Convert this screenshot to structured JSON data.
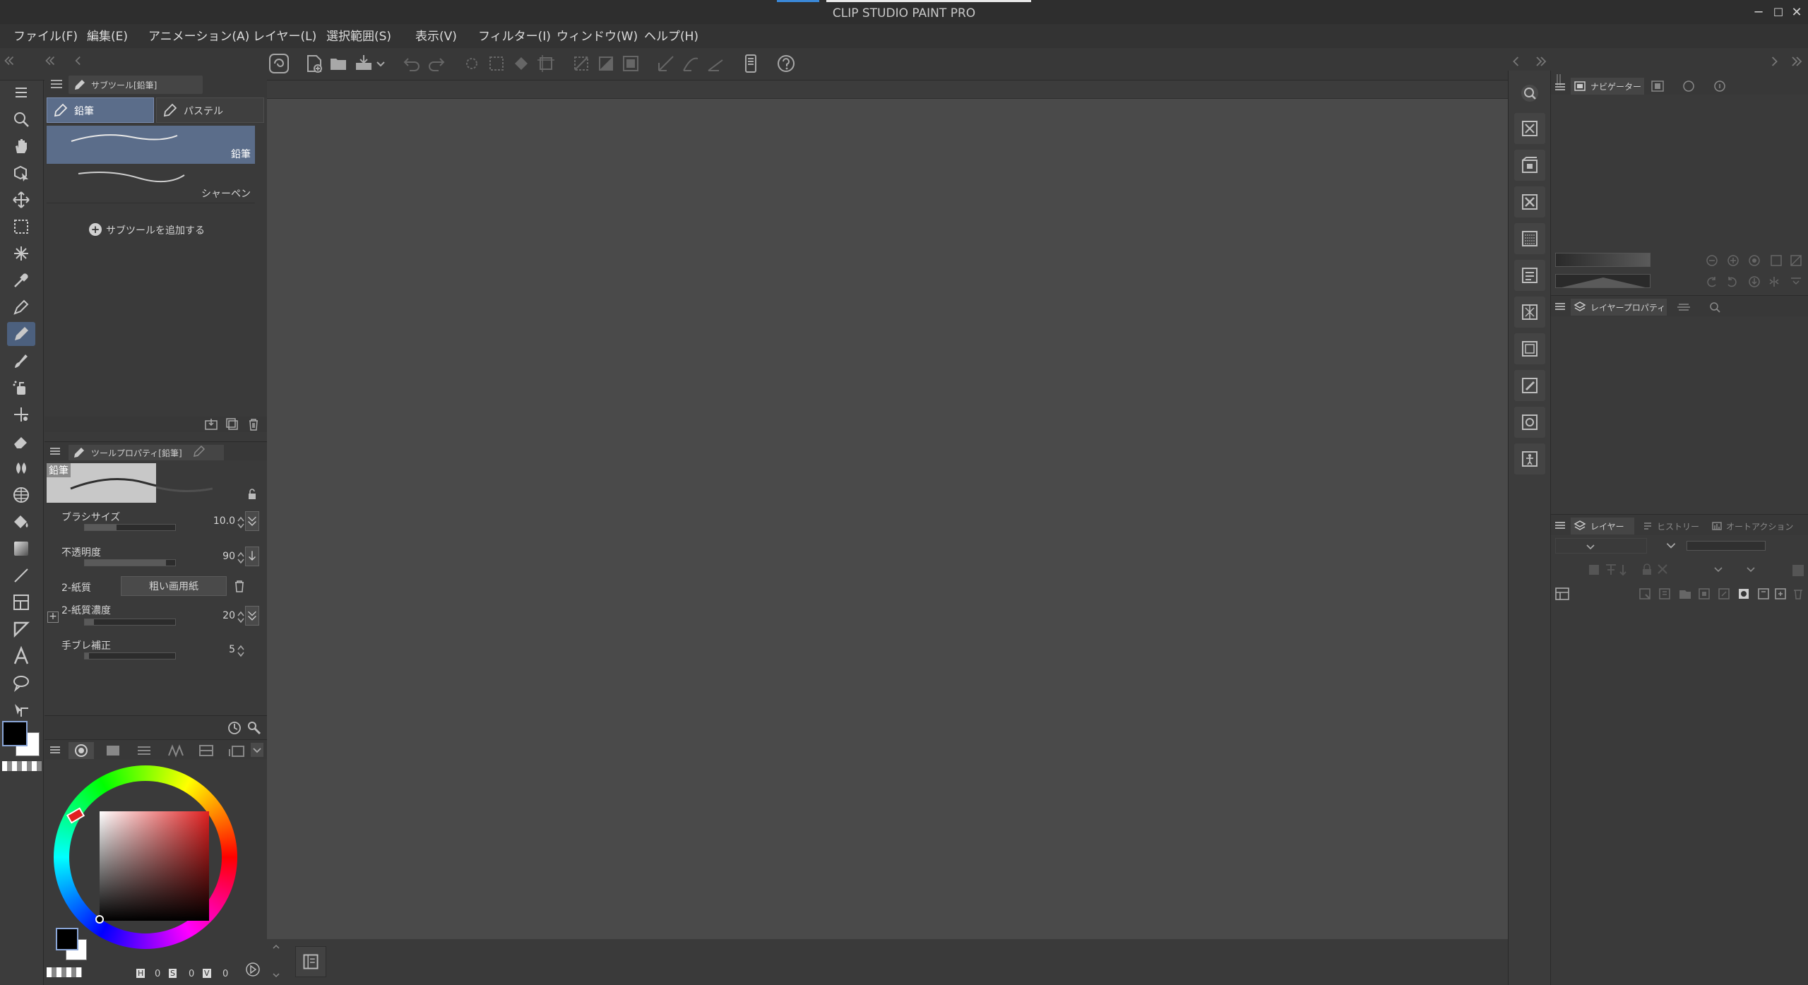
{
  "window": {
    "title": "CLIP STUDIO PAINT PRO",
    "minimize": "─",
    "maximize": "☐",
    "close": "✕"
  },
  "menu": [
    {
      "label": "ファイル(F)"
    },
    {
      "label": "編集(E)"
    },
    {
      "label": "アニメーション(A)"
    },
    {
      "label": "レイヤー(L)"
    },
    {
      "label": "選択範囲(S)"
    },
    {
      "label": "表示(V)"
    },
    {
      "label": "フィルター(I)"
    },
    {
      "label": "ウィンドウ(W)"
    },
    {
      "label": "ヘルプ(H)"
    }
  ],
  "subtool": {
    "tab_title": "サブツール[鉛筆]",
    "groups": [
      "鉛筆",
      "パステル"
    ],
    "items": [
      {
        "name": "鉛筆",
        "selected": true
      },
      {
        "name": "シャーペン",
        "selected": false
      }
    ],
    "add_label": "サブツールを追加する"
  },
  "toolprop": {
    "tab_title": "ツールプロパティ[鉛筆]",
    "preview_label": "鉛筆",
    "rows": [
      {
        "label": "ブラシサイズ",
        "value": "10.0",
        "level": 0.35
      },
      {
        "label": "不透明度",
        "value": "90",
        "level": 0.9
      },
      {
        "label": "2-紙質",
        "button": "粗い画用紙"
      },
      {
        "label": "2-紙質濃度",
        "value": "20",
        "level": 0.1
      },
      {
        "label": "手ブレ補正",
        "value": "5",
        "level": 0.05
      }
    ]
  },
  "color": {
    "main": "#000000",
    "sub": "#ffffff",
    "hue_selected": "#e02020",
    "hsv": [
      {
        "label": "H",
        "value": "0"
      },
      {
        "label": "S",
        "value": "0"
      },
      {
        "label": "V",
        "value": "0"
      }
    ]
  },
  "navigator": {
    "tab_title": "ナビゲーター"
  },
  "layer_property": {
    "tab_title": "レイヤープロパティ"
  },
  "layer_panel": {
    "tabs": [
      "レイヤー",
      "ヒストリー",
      "オートアクション"
    ]
  },
  "colors": {
    "accent": "#3a88d8",
    "selected_tool": "#4c607e",
    "canvas": "#4a4a4a"
  }
}
